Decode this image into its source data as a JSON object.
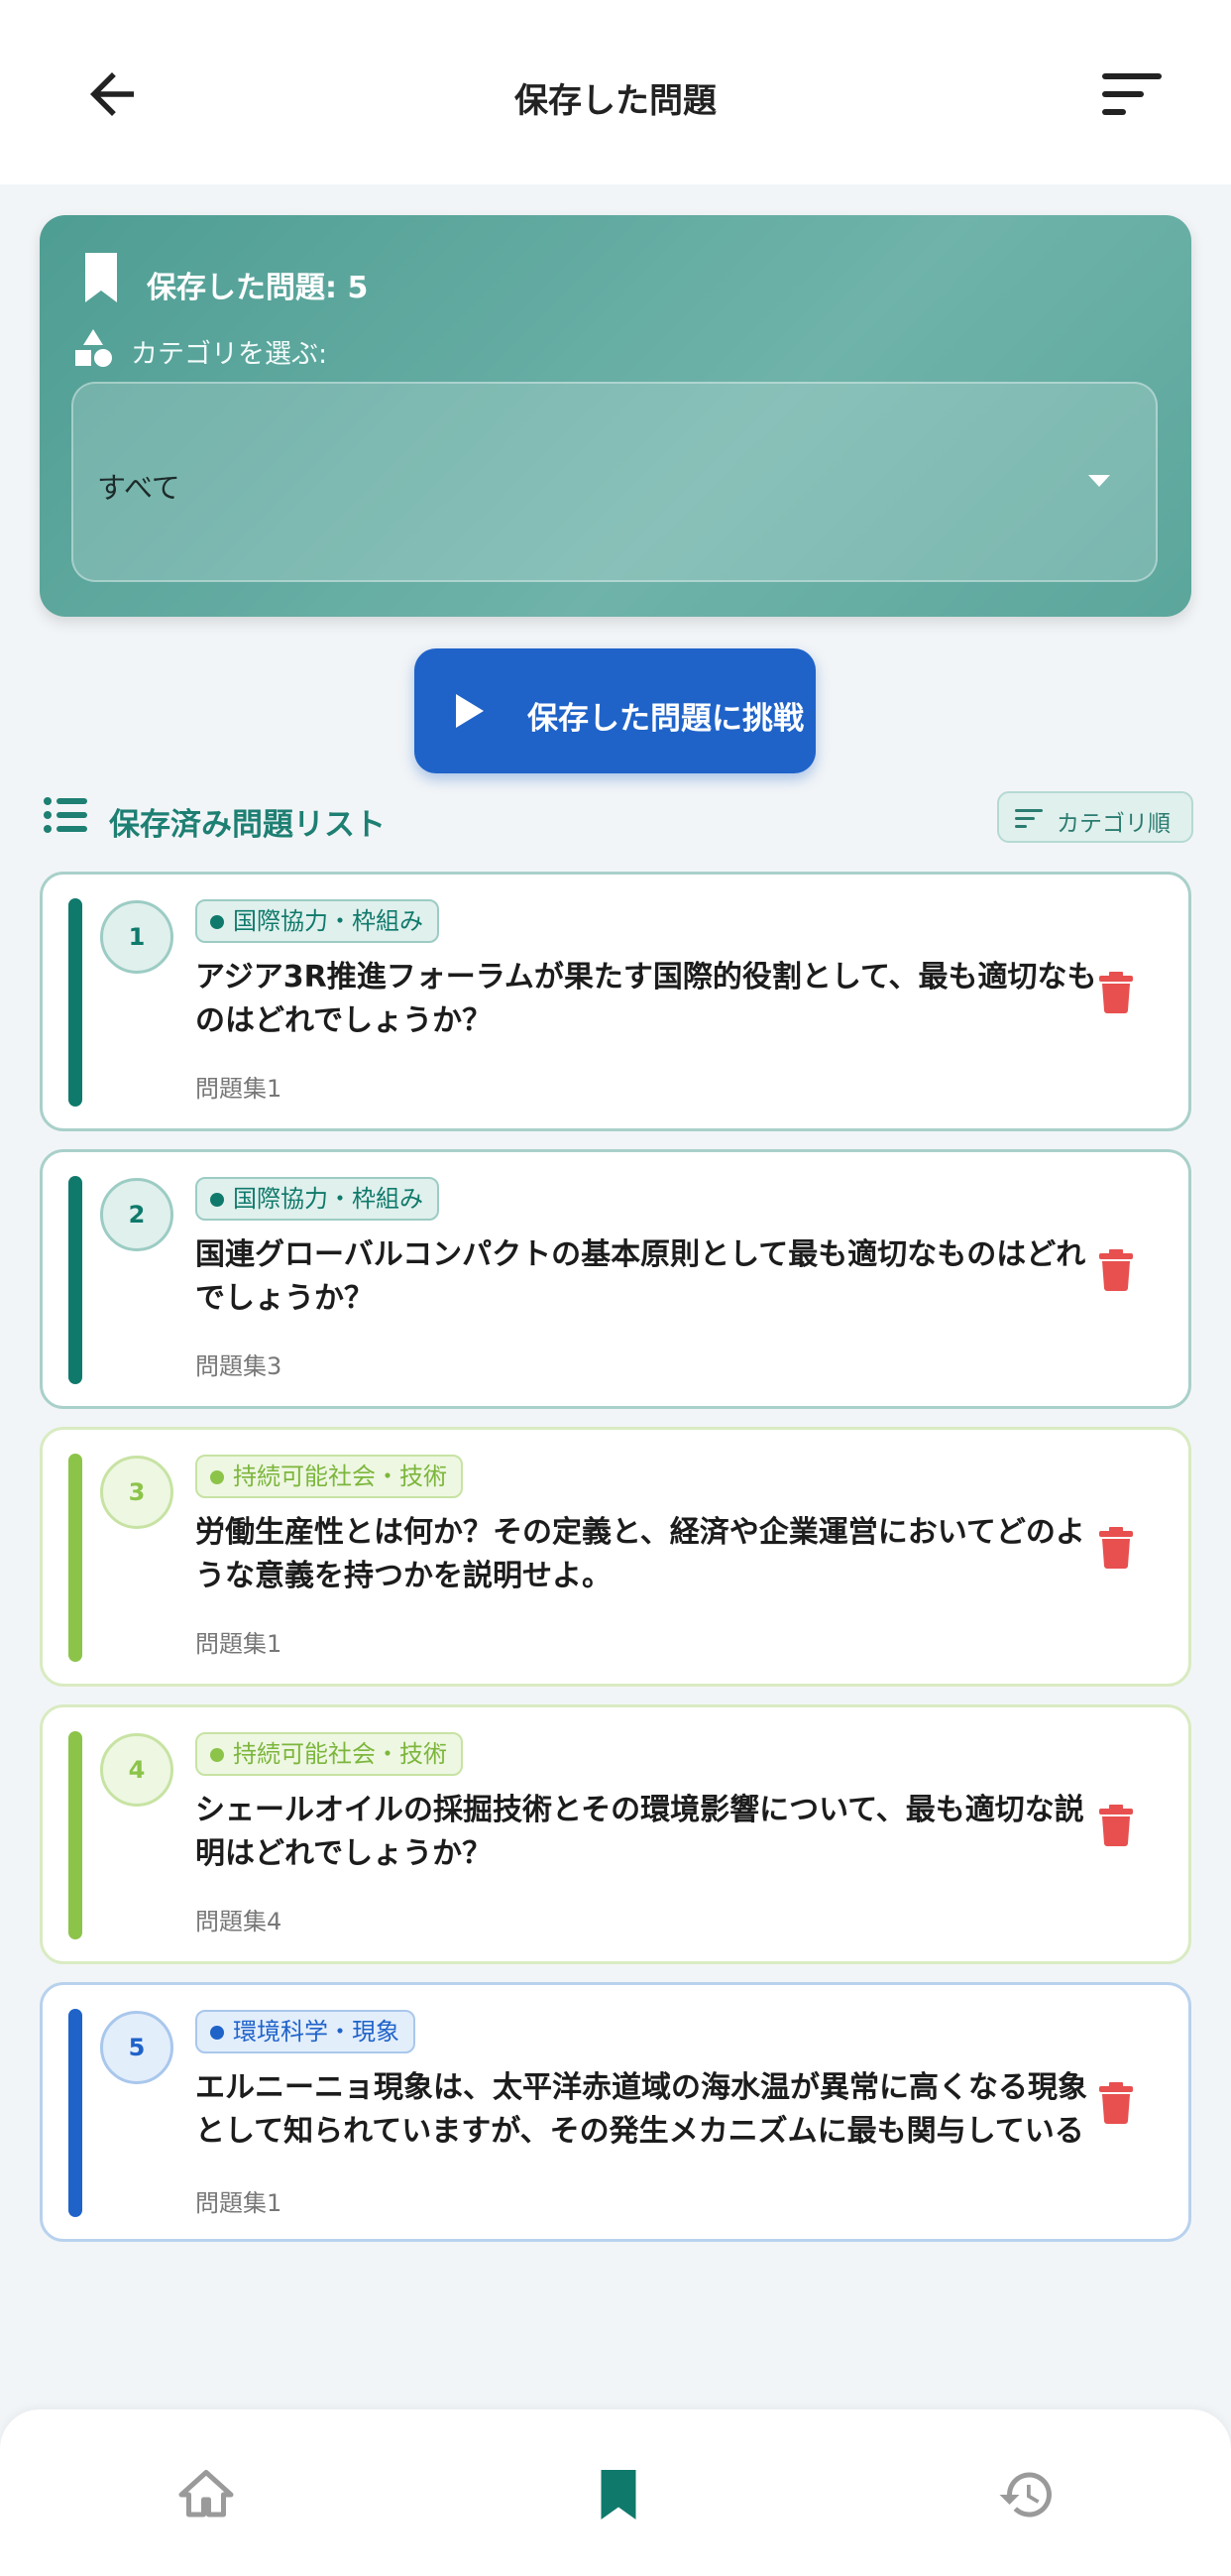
{
  "header": {
    "title": "保存した問題"
  },
  "panel": {
    "saved_count_label": "保存した問題: 5",
    "category_label": "カテゴリを選ぶ:",
    "category_selected": "すべて"
  },
  "challenge_button": {
    "label": "保存した問題に挑戦"
  },
  "list_header": {
    "title": "保存済み問題リスト",
    "sort_chip": "カテゴリ順"
  },
  "questions": [
    {
      "number": "1",
      "category": "国際協力・枠組み",
      "text": "アジア3R推進フォーラムが果たす国際的役割として、最も適切なものはどれでしょうか？",
      "set": "問題集1"
    },
    {
      "number": "2",
      "category": "国際協力・枠組み",
      "text": "国連グローバルコンパクトの基本原則として最も適切なものはどれでしょうか？",
      "set": "問題集3"
    },
    {
      "number": "3",
      "category": "持続可能社会・技術",
      "text": "労働生産性とは何か？その定義と、経済や企業運営においてどのような意義を持つかを説明せよ。",
      "set": "問題集1"
    },
    {
      "number": "4",
      "category": "持続可能社会・技術",
      "text": "シェールオイルの採掘技術とその環境影響について、最も適切な説明はどれでしょうか？",
      "set": "問題集4"
    },
    {
      "number": "5",
      "category": "環境科学・現象",
      "text": "エルニーニョ現象は、太平洋赤道域の海水温が異常に高くなる現象として知られていますが、その発生メカニズムに最も関与している要因はどれでしょうか？",
      "set": "問題集1"
    }
  ],
  "colors": {
    "teal": "#0f7a6b",
    "green": "#8cc44a",
    "blue": "#1f63c9",
    "delete_red": "#e84f4f"
  },
  "icons": [
    "back-arrow-icon",
    "sort-icon",
    "bookmark-icon",
    "shapes-icon",
    "chevron-down-icon",
    "play-icon",
    "list-icon",
    "trash-icon",
    "home-icon",
    "history-icon"
  ]
}
